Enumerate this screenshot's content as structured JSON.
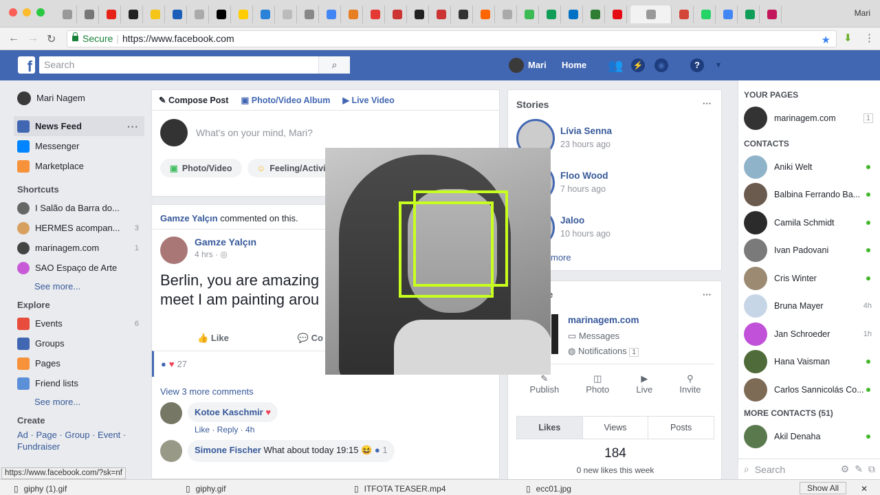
{
  "browser": {
    "window_user": "Mari",
    "url_secure_label": "Secure",
    "url": "https://www.facebook.com",
    "status_url": "https://www.facebook.com/?sk=nf",
    "downloads": [
      "giphy (1).gif",
      "giphy.gif",
      "ITFOTA TEASER.mp4",
      "ecc01.jpg"
    ],
    "show_all_label": "Show All"
  },
  "fb": {
    "search_placeholder": "Search",
    "user_name": "Mari",
    "home_label": "Home"
  },
  "left_nav": {
    "profile_name": "Mari Nagem",
    "main_items": [
      {
        "label": "News Feed",
        "color": "#4267b2"
      },
      {
        "label": "Messenger",
        "color": "#0084ff"
      },
      {
        "label": "Marketplace",
        "color": "#f7923b"
      }
    ],
    "shortcuts_title": "Shortcuts",
    "shortcuts": [
      {
        "label": "I Salão da Barra do...",
        "count": ""
      },
      {
        "label": "HERMES acompan...",
        "count": "3"
      },
      {
        "label": "marinagem.com",
        "count": "1"
      },
      {
        "label": "SAO Espaço de Arte",
        "count": ""
      }
    ],
    "see_more": "See more...",
    "explore_title": "Explore",
    "explore": [
      {
        "label": "Events",
        "count": "6",
        "color": "#e74c3c"
      },
      {
        "label": "Groups",
        "count": "",
        "color": "#4267b2"
      },
      {
        "label": "Pages",
        "count": "",
        "color": "#f7923b"
      },
      {
        "label": "Friend lists",
        "count": "",
        "color": "#5b8fd8"
      }
    ],
    "create_title": "Create",
    "create_links": "Ad · Page · Group · Event · Fundraiser"
  },
  "composer": {
    "tabs": [
      "Compose Post",
      "Photo/Video Album",
      "Live Video"
    ],
    "placeholder": "What's on your mind, Mari?",
    "photo_btn": "Photo/Video",
    "feeling_btn": "Feeling/Activi"
  },
  "post": {
    "context_name": "Gamze Yalçın",
    "context_text": "commented on this.",
    "author": "Gamze Yalçın",
    "time": "4 hrs ·",
    "text_line1": "Berlin, you are amazing",
    "text_line2": "meet I am painting arou",
    "like_label": "Like",
    "comment_label": "Co",
    "reaction_count": "27",
    "view_more_comments": "View 3 more comments",
    "comments": [
      {
        "author": "Kotoe Kaschmir",
        "text": "",
        "actions": "Like · Reply · 4h"
      },
      {
        "author": "Simone Fischer",
        "text": "What about today 19:15 😆",
        "actions": ""
      }
    ],
    "comment_like_count": "1"
  },
  "stories": {
    "title": "Stories",
    "items": [
      {
        "name": "Lívia Senna",
        "time": "23 hours ago"
      },
      {
        "name": "Floo Wood",
        "time": "7 hours ago"
      },
      {
        "name": "Jaloo",
        "time": "10 hours ago"
      }
    ],
    "see_more": "more"
  },
  "page_widget": {
    "title_fragment": "ge",
    "page_name": "marinagem.com",
    "messages": "Messages",
    "notifications": "Notifications",
    "notif_count": "1",
    "actions": [
      "Publish",
      "Photo",
      "Live",
      "Invite"
    ],
    "tabs": [
      "Likes",
      "Views",
      "Posts"
    ],
    "likes_count": "184",
    "likes_sub": "0 new likes this week"
  },
  "right_sidebar": {
    "your_pages_title": "YOUR PAGES",
    "page": {
      "name": "marinagem.com",
      "count": "1"
    },
    "contacts_title": "CONTACTS",
    "contacts": [
      {
        "name": "Aniki Welt",
        "status": "online",
        "time": "",
        "color": "#8fb3c9"
      },
      {
        "name": "Balbina Ferrando Ba...",
        "status": "online",
        "time": "",
        "color": "#6b5a4e"
      },
      {
        "name": "Camila Schmidt",
        "status": "online",
        "time": "",
        "color": "#2b2b2b"
      },
      {
        "name": "Ivan Padovani",
        "status": "online",
        "time": "",
        "color": "#7a7a7a"
      },
      {
        "name": "Cris Winter",
        "status": "online",
        "time": "",
        "color": "#9c8a72"
      },
      {
        "name": "Bruna Mayer",
        "status": "",
        "time": "4h",
        "color": "#c7d6e6"
      },
      {
        "name": "Jan Schroeder",
        "status": "",
        "time": "1h",
        "color": "#c051d8"
      },
      {
        "name": "Hana Vaisman",
        "status": "online",
        "time": "",
        "color": "#4f6b3a"
      },
      {
        "name": "Carlos Sannicolás Co...",
        "status": "online",
        "time": "",
        "color": "#7d6b55"
      }
    ],
    "more_contacts_title": "MORE CONTACTS (51)",
    "more_contacts": [
      {
        "name": "Akil Denaha",
        "status": "online",
        "color": "#5a7a4e"
      }
    ],
    "search_placeholder": "Search"
  },
  "colors": {
    "fb_blue": "#4267b2",
    "link_blue": "#365899",
    "overlay_box": "#c8ff1e"
  }
}
